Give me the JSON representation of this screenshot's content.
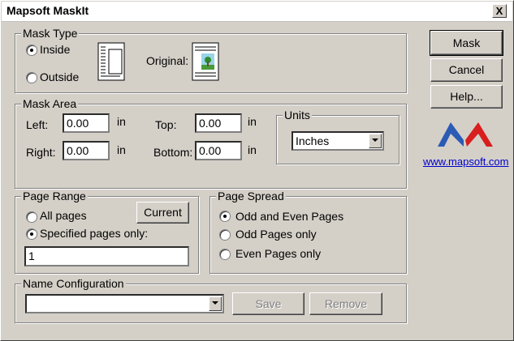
{
  "window": {
    "title": "Mapsoft MaskIt",
    "close_label": "X"
  },
  "mask_type": {
    "legend": "Mask Type",
    "inside_label": "Inside",
    "inside_checked": true,
    "outside_label": "Outside",
    "outside_checked": false,
    "original_label": "Original:"
  },
  "mask_area": {
    "legend": "Mask Area",
    "left_label": "Left:",
    "left_value": "0.00",
    "left_unit": "in",
    "right_label": "Right:",
    "right_value": "0.00",
    "right_unit": "in",
    "top_label": "Top:",
    "top_value": "0.00",
    "top_unit": "in",
    "bottom_label": "Bottom:",
    "bottom_value": "0.00",
    "bottom_unit": "in",
    "units": {
      "legend": "Units",
      "selected": "Inches"
    }
  },
  "page_range": {
    "legend": "Page Range",
    "all_pages_label": "All pages",
    "all_pages_checked": false,
    "specified_label": "Specified pages only:",
    "specified_checked": true,
    "current_button": "Current",
    "pages_value": "1"
  },
  "page_spread": {
    "legend": "Page Spread",
    "odd_even_label": "Odd and Even Pages",
    "odd_even_checked": true,
    "odd_label": "Odd Pages only",
    "odd_checked": false,
    "even_label": "Even Pages only",
    "even_checked": false
  },
  "name_configuration": {
    "legend": "Name Configuration",
    "selected": "",
    "save_button": "Save",
    "remove_button": "Remove"
  },
  "actions": {
    "mask_button": "Mask",
    "cancel_button": "Cancel",
    "help_button": "Help..."
  },
  "brand": {
    "link": "www.mapsoft.com",
    "logo_colors": [
      "#2b5bb5",
      "#d81e1e"
    ]
  },
  "colors": {
    "dialog_bg": "#d4d0c8",
    "link": "#0000cc"
  }
}
